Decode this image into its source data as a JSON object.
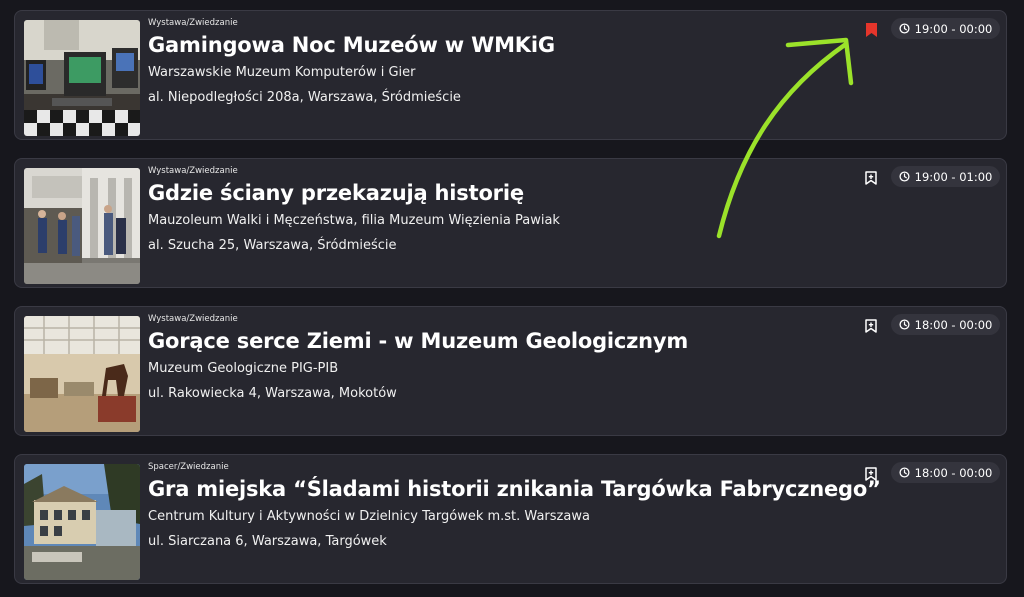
{
  "events": [
    {
      "category": "Wystawa/Zwiedzanie",
      "title": "Gamingowa Noc Muzeów w WMKiG",
      "venue": "Warszawskie Muzeum Komputerów i Gier",
      "address": "al. Niepodległości 208a, Warszawa, Śródmieście",
      "time": "19:00 - 00:00",
      "bookmarked": true,
      "thumbnail_icon": "computer-museum-photo"
    },
    {
      "category": "Wystawa/Zwiedzanie",
      "title": "Gdzie ściany przekazują historię",
      "venue": "Mauzoleum Walki i Męczeństwa, filia Muzeum Więzienia Pawiak",
      "address": "al. Szucha 25, Warszawa, Śródmieście",
      "time": "19:00 - 01:00",
      "bookmarked": false,
      "thumbnail_icon": "mausoleum-entrance-photo"
    },
    {
      "category": "Wystawa/Zwiedzanie",
      "title": "Gorące serce Ziemi - w Muzeum Geologicznym",
      "venue": "Muzeum Geologiczne PIG-PIB",
      "address": "ul. Rakowiecka 4, Warszawa, Mokotów",
      "time": "18:00 - 00:00",
      "bookmarked": false,
      "thumbnail_icon": "geological-hall-photo"
    },
    {
      "category": "Spacer/Zwiedzanie",
      "title": "Gra miejska “Śladami historii znikania Targówka Fabrycznego”",
      "venue": "Centrum Kultury i Aktywności w Dzielnicy Targówek m.st. Warszawa",
      "address": "ul. Siarczana 6, Warszawa, Targówek",
      "time": "18:00 - 00:00",
      "bookmarked": false,
      "thumbnail_icon": "building-exterior-photo"
    }
  ],
  "colors": {
    "background": "#17171d",
    "card": "#27272f",
    "bookmark_active": "#e5352b",
    "annotation_arrow": "#9be22a"
  },
  "icons": [
    "bookmark-icon",
    "bookmark-add-icon",
    "clock-icon",
    "annotation-arrow"
  ]
}
